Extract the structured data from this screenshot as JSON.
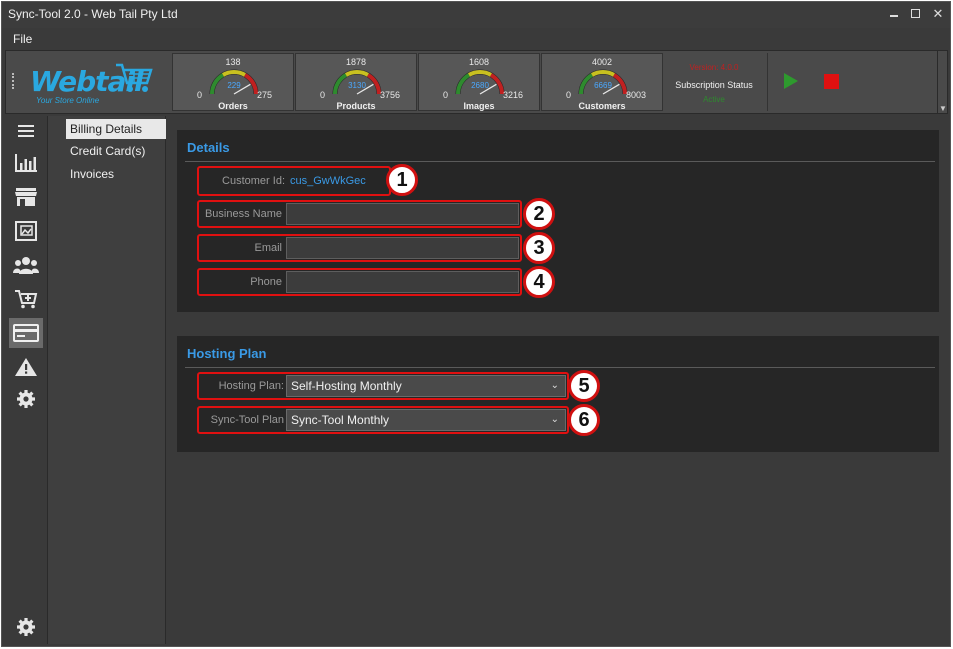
{
  "window": {
    "title": "Sync-Tool 2.0 - Web Tail Pty Ltd"
  },
  "menu": {
    "file": "File"
  },
  "toolbar": {
    "logo_text": "Webtail",
    "logo_tagline": "Your Store Online",
    "gauges": [
      {
        "label": "Orders",
        "total": "138",
        "min": "0",
        "max": "275",
        "value": "229",
        "fraction": 0.83
      },
      {
        "label": "Products",
        "total": "1878",
        "min": "0",
        "max": "3756",
        "value": "3130",
        "fraction": 0.83
      },
      {
        "label": "Images",
        "total": "1608",
        "min": "0",
        "max": "3216",
        "value": "2680",
        "fraction": 0.83
      },
      {
        "label": "Customers",
        "total": "4002",
        "min": "0",
        "max": "8003",
        "value": "6669",
        "fraction": 0.83
      }
    ],
    "version": "Version: 4.0.0",
    "subscription_label": "Subscription Status",
    "subscription_state": "Active"
  },
  "leftnav": {
    "items": [
      "menu",
      "reports",
      "store",
      "products",
      "customers",
      "orders",
      "billing",
      "alerts",
      "settings"
    ],
    "active": "billing"
  },
  "subnav": {
    "items": [
      {
        "label": "Billing Details",
        "active": true
      },
      {
        "label": "Credit Card(s)",
        "active": false
      },
      {
        "label": "Invoices",
        "active": false
      }
    ]
  },
  "details": {
    "heading": "Details",
    "customer_id_label": "Customer Id:",
    "customer_id_value": "cus_GwWkGec",
    "business_name_label": "Business Name",
    "business_name_value": "",
    "email_label": "Email",
    "email_value": "",
    "phone_label": "Phone",
    "phone_value": ""
  },
  "hosting": {
    "heading": "Hosting Plan",
    "hosting_plan_label": "Hosting Plan:",
    "hosting_plan_value": "Self-Hosting Monthly",
    "sync_plan_label": "Sync-Tool Plan",
    "sync_plan_value": "Sync-Tool Monthly"
  },
  "badges": [
    "1",
    "2",
    "3",
    "4",
    "5",
    "6"
  ],
  "colors": {
    "accent": "#3a9ae6",
    "highlight": "#e01010",
    "active_green": "#2e9a2e"
  }
}
